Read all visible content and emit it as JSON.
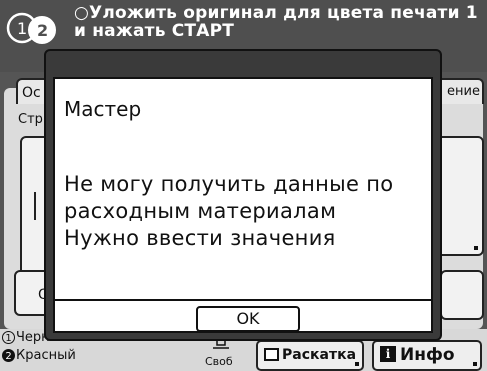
{
  "header": {
    "drum_icons": [
      "1",
      "2"
    ],
    "message": "○Уложить оригинал для цвета печати 1\nи нажать СТАРТ"
  },
  "background": {
    "tab_left": "Ос",
    "tab_right": "ение",
    "page_label": "Стр.",
    "button_o": "О"
  },
  "footer": {
    "colors": [
      {
        "num": "1",
        "label": "Черный"
      },
      {
        "num": "2",
        "label": "Красный"
      }
    ],
    "free_label": "Своб",
    "roll_button": "Раскатка",
    "info_button": "Инфо"
  },
  "dialog": {
    "title": "Мастер",
    "message": "Не могу получить данные по\nрасходным материалам\nНужно ввести значения",
    "ok_label": "OK"
  },
  "colors": {
    "screen_bg": "#555555",
    "dialog_frame": "#3a3a3a",
    "dialog_body": "#ffffff"
  }
}
